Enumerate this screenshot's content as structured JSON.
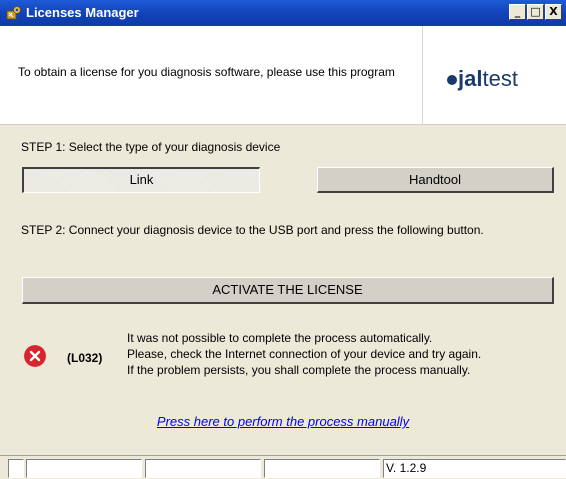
{
  "window": {
    "title": "Licenses Manager",
    "icon": "licenses-app-icon",
    "controls": {
      "minimize": "_",
      "maximize": "□",
      "close": "X"
    }
  },
  "header": {
    "instruction": "To obtain a license for you diagnosis software, please use this program",
    "logo": {
      "brand_part1": "jal",
      "brand_part2": "test",
      "color": "#1a3a6b"
    }
  },
  "step1": {
    "text": "STEP 1: Select the type of your diagnosis device",
    "options": {
      "link": "Link",
      "handtool": "Handtool"
    },
    "selected": "Link"
  },
  "step2": {
    "text": "STEP 2: Connect your diagnosis device to the USB port and press the following button."
  },
  "activate_button": "ACTIVATE THE LICENSE",
  "error": {
    "icon": "error-x-icon",
    "color": "#d9232e",
    "code": "(L032)",
    "lines": [
      "It was not possible to complete the process automatically.",
      "Please, check the Internet connection of your device and try again.",
      "If the problem persists, you shall complete the process manually."
    ]
  },
  "manual_link": "Press here to perform the process manually",
  "status": {
    "cells": [
      "",
      "",
      "",
      ""
    ],
    "version": "V. 1.2.9"
  }
}
